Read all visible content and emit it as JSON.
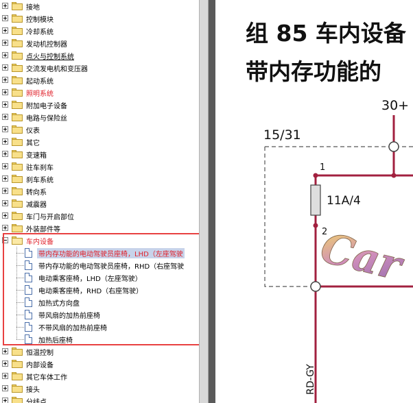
{
  "tree": {
    "items_before": [
      {
        "label": "接地"
      },
      {
        "label": "控制模块"
      },
      {
        "label": "冷却系统"
      },
      {
        "label": "发动机控制器"
      },
      {
        "label": "点火与控制系统",
        "underline": true
      },
      {
        "label": "交流发电机和变压器"
      },
      {
        "label": "起动系统"
      },
      {
        "label": "照明系统",
        "color": "red"
      },
      {
        "label": "附加电子设备"
      },
      {
        "label": "电路与保险丝"
      },
      {
        "label": "仪表"
      },
      {
        "label": "其它"
      },
      {
        "label": "变速箱"
      },
      {
        "label": "驻车刹车"
      },
      {
        "label": "刹车系统"
      },
      {
        "label": "转向系"
      },
      {
        "label": "减震器"
      },
      {
        "label": "车门与开启部位"
      },
      {
        "label": "外装部件等"
      }
    ],
    "open_folder": {
      "label": "车内设备"
    },
    "children": [
      {
        "label": "带内存功能的电动驾驶员座椅，LHD（左座驾驶",
        "selected": true
      },
      {
        "label": "带内存功能的电动驾驶员座椅，RHD（右座驾驶"
      },
      {
        "label": "电动乘客座椅，LHD（左座驾驶）"
      },
      {
        "label": "电动乘客座椅，RHD（右座驾驶）"
      },
      {
        "label": "加热式方向盘"
      },
      {
        "label": "带风扇的加热前座椅"
      },
      {
        "label": "不带风扇的加热前座椅"
      },
      {
        "label": "加热后座椅"
      }
    ],
    "items_after": [
      {
        "label": "恒温控制"
      },
      {
        "label": "内部设备"
      },
      {
        "label": "其它车体工作"
      },
      {
        "label": "接头"
      },
      {
        "label": "分线点"
      }
    ]
  },
  "document": {
    "title_line1": "组 85 车内设备",
    "title_line2": "带内存功能的",
    "labels": {
      "terminal_30": "30+",
      "terminal_15_31": "15/31",
      "pin_1": "1",
      "pin_2": "2",
      "fuse": "11A/4",
      "wire_color": "RD-GY",
      "watermark": "Car"
    }
  },
  "colors": {
    "wire": "#a2203f",
    "highlight": "#e84040",
    "tree_red": "#e0202a",
    "selection": "#c7d3ea"
  }
}
